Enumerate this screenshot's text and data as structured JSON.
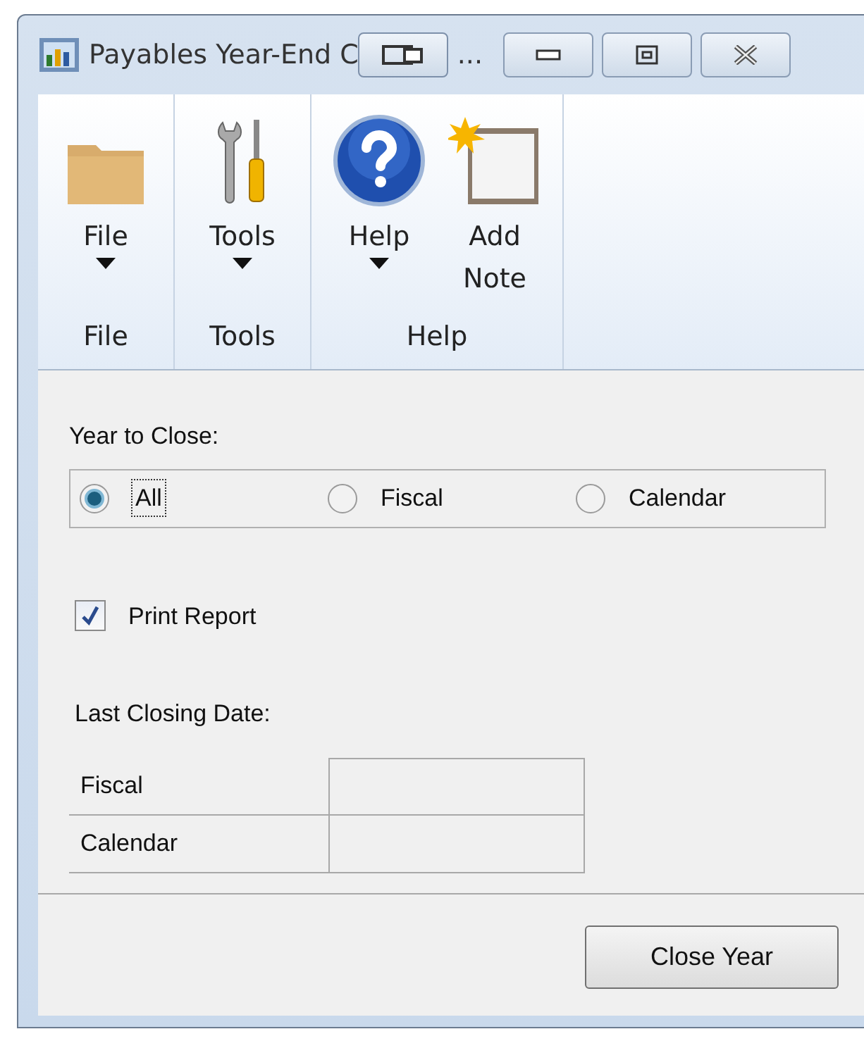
{
  "window": {
    "title": "Payables Year-End C",
    "title_more": "..."
  },
  "ribbon": {
    "groups": [
      {
        "label": "File",
        "buttons": [
          {
            "kind": "folder",
            "label": "File",
            "dropdown": true
          }
        ]
      },
      {
        "label": "Tools",
        "buttons": [
          {
            "kind": "tools",
            "label": "Tools",
            "dropdown": true
          }
        ]
      },
      {
        "label": "Help",
        "buttons": [
          {
            "kind": "help",
            "label": "Help",
            "dropdown": true
          },
          {
            "kind": "note",
            "label": "Add Note",
            "dropdown": false
          }
        ]
      }
    ]
  },
  "year_to_close": {
    "label": "Year to Close:",
    "options": [
      {
        "label": "All",
        "selected": true
      },
      {
        "label": "Fiscal",
        "selected": false
      },
      {
        "label": "Calendar",
        "selected": false
      }
    ]
  },
  "print_report": {
    "label": "Print Report",
    "checked": true
  },
  "last_closing_date": {
    "label": "Last Closing Date:",
    "rows": [
      {
        "label": "Fiscal"
      },
      {
        "label": "Calendar"
      }
    ]
  },
  "buttons": [
    {
      "label": "Close Year"
    }
  ]
}
